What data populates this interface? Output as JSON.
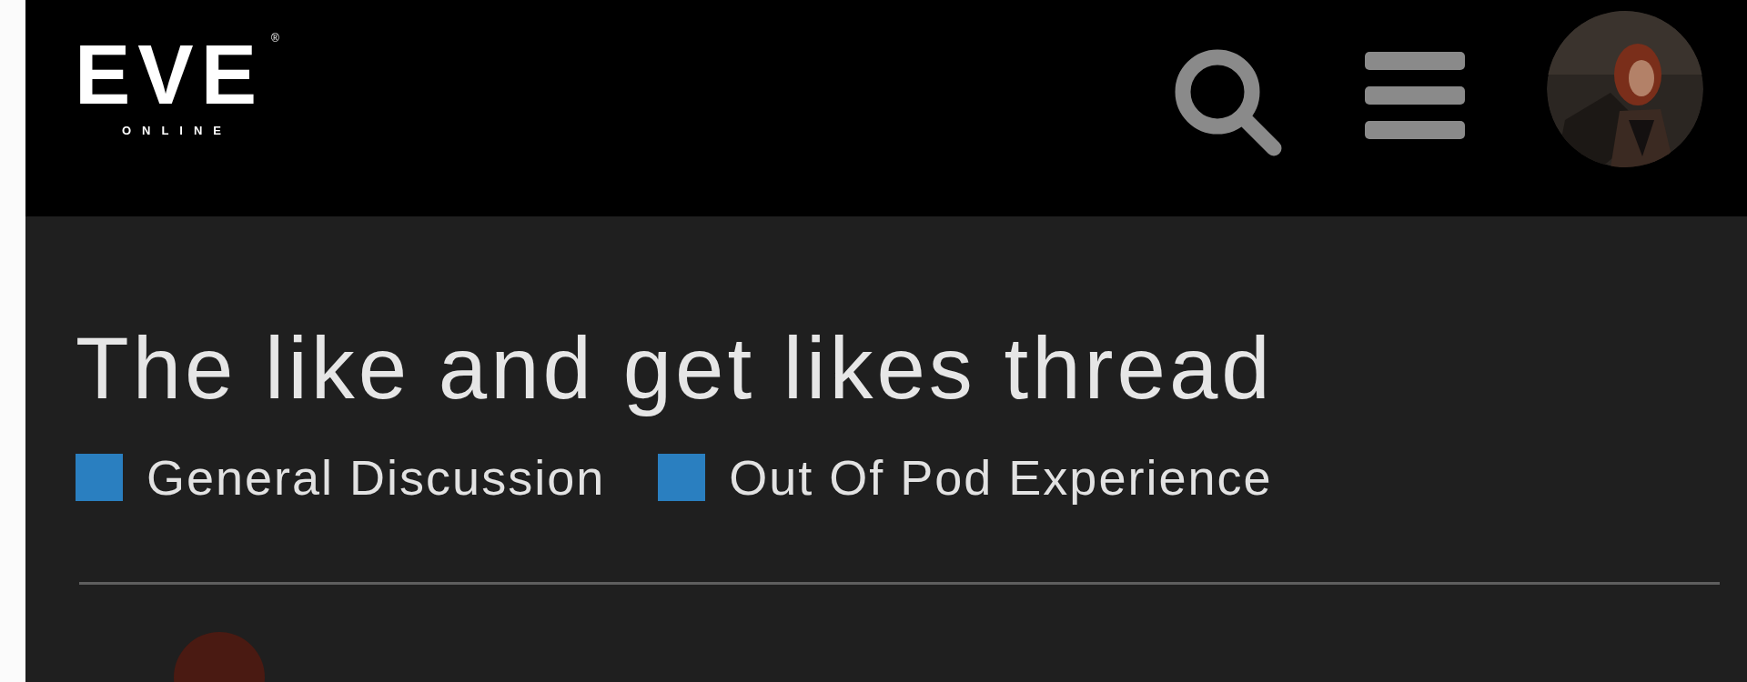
{
  "header": {
    "logo": {
      "wordmark": "EVE",
      "subtitle": "ONLINE",
      "mark": "®"
    }
  },
  "topic": {
    "title": "The like and get likes thread",
    "categories": [
      {
        "name": "General Discussion",
        "color": "#2a7fc0"
      },
      {
        "name": "Out Of Pod Experience",
        "color": "#2a7fc0"
      }
    ]
  }
}
